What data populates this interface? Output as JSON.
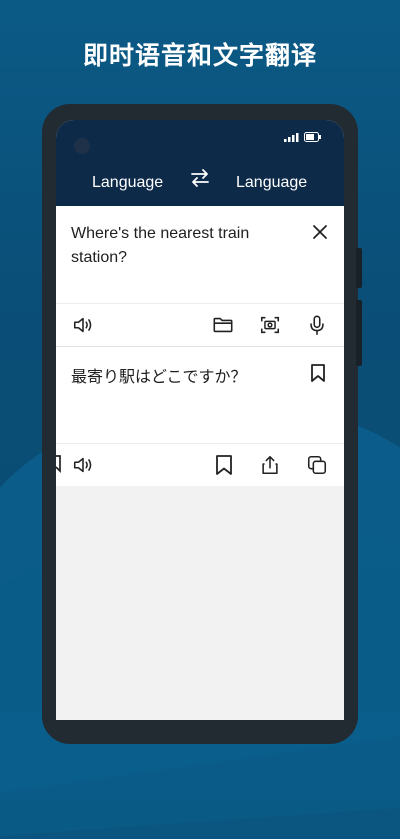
{
  "headline": "即时语音和文字翻译",
  "languages": {
    "source": "Language",
    "target": "Language"
  },
  "input": {
    "text": "Where's the nearest train station?"
  },
  "output": {
    "text": "最寄り駅はどこですか？"
  },
  "icons": {
    "swap": "swap-arrows-icon",
    "clear": "close-icon",
    "speaker": "speaker-icon",
    "folder": "folder-icon",
    "camera": "camera-icon",
    "mic": "microphone-icon",
    "bookmark": "bookmark-icon",
    "share": "share-icon",
    "copy": "copy-icon"
  },
  "colors": {
    "accent": "#0d2a49",
    "background": "#0b5a86"
  }
}
